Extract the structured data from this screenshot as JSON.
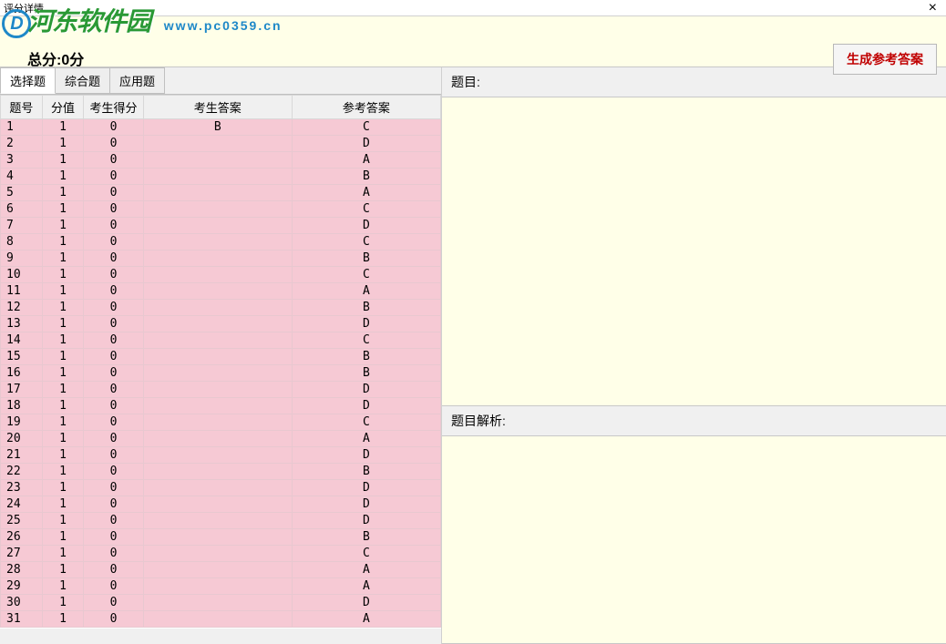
{
  "window": {
    "title": "评分详情"
  },
  "watermark": {
    "logo_text": "河东软件园",
    "url": "www.pc0359.cn"
  },
  "top": {
    "score_label": "总分:0分",
    "generate_button": "生成参考答案"
  },
  "tabs": [
    {
      "label": "选择题",
      "active": true
    },
    {
      "label": "综合题",
      "active": false
    },
    {
      "label": "应用题",
      "active": false
    }
  ],
  "table": {
    "headers": [
      "题号",
      "分值",
      "考生得分",
      "考生答案",
      "参考答案"
    ],
    "rows": [
      {
        "num": "1",
        "val": "1",
        "score": "0",
        "ans": "B",
        "ref": "C"
      },
      {
        "num": "2",
        "val": "1",
        "score": "0",
        "ans": "",
        "ref": "D"
      },
      {
        "num": "3",
        "val": "1",
        "score": "0",
        "ans": "",
        "ref": "A"
      },
      {
        "num": "4",
        "val": "1",
        "score": "0",
        "ans": "",
        "ref": "B"
      },
      {
        "num": "5",
        "val": "1",
        "score": "0",
        "ans": "",
        "ref": "A"
      },
      {
        "num": "6",
        "val": "1",
        "score": "0",
        "ans": "",
        "ref": "C"
      },
      {
        "num": "7",
        "val": "1",
        "score": "0",
        "ans": "",
        "ref": "D"
      },
      {
        "num": "8",
        "val": "1",
        "score": "0",
        "ans": "",
        "ref": "C"
      },
      {
        "num": "9",
        "val": "1",
        "score": "0",
        "ans": "",
        "ref": "B"
      },
      {
        "num": "10",
        "val": "1",
        "score": "0",
        "ans": "",
        "ref": "C"
      },
      {
        "num": "11",
        "val": "1",
        "score": "0",
        "ans": "",
        "ref": "A"
      },
      {
        "num": "12",
        "val": "1",
        "score": "0",
        "ans": "",
        "ref": "B"
      },
      {
        "num": "13",
        "val": "1",
        "score": "0",
        "ans": "",
        "ref": "D"
      },
      {
        "num": "14",
        "val": "1",
        "score": "0",
        "ans": "",
        "ref": "C"
      },
      {
        "num": "15",
        "val": "1",
        "score": "0",
        "ans": "",
        "ref": "B"
      },
      {
        "num": "16",
        "val": "1",
        "score": "0",
        "ans": "",
        "ref": "B"
      },
      {
        "num": "17",
        "val": "1",
        "score": "0",
        "ans": "",
        "ref": "D"
      },
      {
        "num": "18",
        "val": "1",
        "score": "0",
        "ans": "",
        "ref": "D"
      },
      {
        "num": "19",
        "val": "1",
        "score": "0",
        "ans": "",
        "ref": "C"
      },
      {
        "num": "20",
        "val": "1",
        "score": "0",
        "ans": "",
        "ref": "A"
      },
      {
        "num": "21",
        "val": "1",
        "score": "0",
        "ans": "",
        "ref": "D"
      },
      {
        "num": "22",
        "val": "1",
        "score": "0",
        "ans": "",
        "ref": "B"
      },
      {
        "num": "23",
        "val": "1",
        "score": "0",
        "ans": "",
        "ref": "D"
      },
      {
        "num": "24",
        "val": "1",
        "score": "0",
        "ans": "",
        "ref": "D"
      },
      {
        "num": "25",
        "val": "1",
        "score": "0",
        "ans": "",
        "ref": "D"
      },
      {
        "num": "26",
        "val": "1",
        "score": "0",
        "ans": "",
        "ref": "B"
      },
      {
        "num": "27",
        "val": "1",
        "score": "0",
        "ans": "",
        "ref": "C"
      },
      {
        "num": "28",
        "val": "1",
        "score": "0",
        "ans": "",
        "ref": "A"
      },
      {
        "num": "29",
        "val": "1",
        "score": "0",
        "ans": "",
        "ref": "A"
      },
      {
        "num": "30",
        "val": "1",
        "score": "0",
        "ans": "",
        "ref": "D"
      },
      {
        "num": "31",
        "val": "1",
        "score": "0",
        "ans": "",
        "ref": "A"
      }
    ]
  },
  "right": {
    "question_label": "题目:",
    "analysis_label": "题目解析:"
  }
}
